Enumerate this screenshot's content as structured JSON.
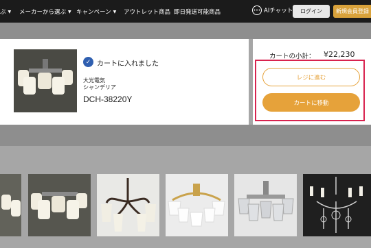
{
  "nav": {
    "items": [
      {
        "label": "ぶ",
        "caret": "▼"
      },
      {
        "label": "メーカーから選ぶ",
        "caret": "▼"
      },
      {
        "label": "キャンペーン",
        "caret": "▼"
      },
      {
        "label": "アウトレット商品",
        "caret": ""
      },
      {
        "label": "即日発送可能商品",
        "caret": ""
      }
    ],
    "ai_label": "AIチャット",
    "login_label": "ログイン",
    "register_label": "新規会員登録"
  },
  "cart": {
    "added_message": "カートに入れました",
    "brand": "大光電気",
    "category": "シャンデリア",
    "model": "DCH-38220Y"
  },
  "summary": {
    "subtotal_label": "カートの小計：",
    "subtotal_value": "¥22,230",
    "checkout_label": "レジに進む",
    "cart_label": "カートに移動"
  },
  "colors": {
    "accent": "#e6a23a",
    "highlight": "#d8224e",
    "check": "#2f5fb0",
    "nav_bg": "#1b1b1b"
  },
  "icons": [
    "check-circle-icon",
    "ai-chat-icon",
    "chevron-down-icon"
  ]
}
